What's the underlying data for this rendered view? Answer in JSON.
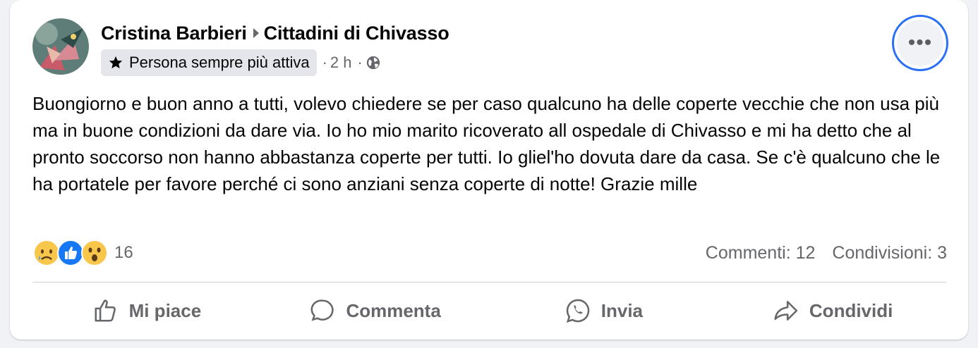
{
  "post": {
    "author": "Cristina Barbieri",
    "group": "Cittadini di Chivasso",
    "badge": "Persona sempre più attiva",
    "time": "2 h",
    "meta_separator": "·",
    "more_label": "•••",
    "text": "Buongiorno e buon anno a tutti, volevo chiedere se per caso qualcuno ha delle coperte vecchie che non usa più ma in buone condizioni da dare via. Io ho mio marito ricoverato all ospedale di Chivasso e mi ha detto che al pronto soccorso non hanno abbastanza coperte per tutti. Io gliel'ho dovuta dare da casa. Se c'è qualcuno che le ha portatele per favore perché ci sono anziani senza coperte di notte! Grazie mille"
  },
  "reactions": {
    "icons": [
      "sad-reaction-icon",
      "like-reaction-icon",
      "wow-reaction-icon"
    ],
    "count": "16"
  },
  "stats": {
    "comments": "Commenti: 12",
    "shares": "Condivisioni: 3"
  },
  "actions": {
    "like": "Mi piace",
    "comment": "Commenta",
    "send": "Invia",
    "share": "Condividi"
  },
  "colors": {
    "focus_ring": "#2a6ff5",
    "like_blue": "#1877f2",
    "secondary_text": "#65676b"
  }
}
